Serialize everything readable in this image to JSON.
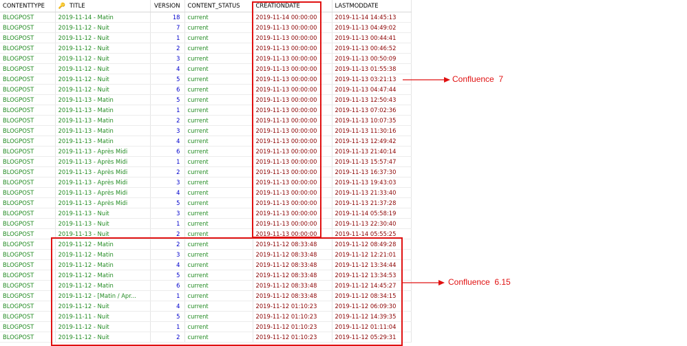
{
  "columns": {
    "contenttype": "CONTENTTYPE",
    "title": "TITLE",
    "version": "VERSION",
    "content_status": "CONTENT_STATUS",
    "creationdate": "CREATIONDATE",
    "lastmoddate": "LASTMODDATE"
  },
  "rows": [
    {
      "type": "BLOGPOST",
      "title": "2019-11-14 - Matin",
      "version": "18",
      "status": "current",
      "created": "2019-11-14 00:00:00",
      "modified": "2019-11-14 14:45:13"
    },
    {
      "type": "BLOGPOST",
      "title": "2019-11-12 - Nuit",
      "version": "7",
      "status": "current",
      "created": "2019-11-13 00:00:00",
      "modified": "2019-11-13 04:49:02"
    },
    {
      "type": "BLOGPOST",
      "title": "2019-11-12 - Nuit",
      "version": "1",
      "status": "current",
      "created": "2019-11-13 00:00:00",
      "modified": "2019-11-13 00:44:41"
    },
    {
      "type": "BLOGPOST",
      "title": "2019-11-12 - Nuit",
      "version": "2",
      "status": "current",
      "created": "2019-11-13 00:00:00",
      "modified": "2019-11-13 00:46:52"
    },
    {
      "type": "BLOGPOST",
      "title": "2019-11-12 - Nuit",
      "version": "3",
      "status": "current",
      "created": "2019-11-13 00:00:00",
      "modified": "2019-11-13 00:50:09"
    },
    {
      "type": "BLOGPOST",
      "title": "2019-11-12 - Nuit",
      "version": "4",
      "status": "current",
      "created": "2019-11-13 00:00:00",
      "modified": "2019-11-13 01:55:38"
    },
    {
      "type": "BLOGPOST",
      "title": "2019-11-12 - Nuit",
      "version": "5",
      "status": "current",
      "created": "2019-11-13 00:00:00",
      "modified": "2019-11-13 03:21:13"
    },
    {
      "type": "BLOGPOST",
      "title": "2019-11-12 - Nuit",
      "version": "6",
      "status": "current",
      "created": "2019-11-13 00:00:00",
      "modified": "2019-11-13 04:47:44"
    },
    {
      "type": "BLOGPOST",
      "title": "2019-11-13 - Matin",
      "version": "5",
      "status": "current",
      "created": "2019-11-13 00:00:00",
      "modified": "2019-11-13 12:50:43"
    },
    {
      "type": "BLOGPOST",
      "title": "2019-11-13 - Matin",
      "version": "1",
      "status": "current",
      "created": "2019-11-13 00:00:00",
      "modified": "2019-11-13 07:02:36"
    },
    {
      "type": "BLOGPOST",
      "title": "2019-11-13 - Matin",
      "version": "2",
      "status": "current",
      "created": "2019-11-13 00:00:00",
      "modified": "2019-11-13 10:07:35"
    },
    {
      "type": "BLOGPOST",
      "title": "2019-11-13 - Matin",
      "version": "3",
      "status": "current",
      "created": "2019-11-13 00:00:00",
      "modified": "2019-11-13 11:30:16"
    },
    {
      "type": "BLOGPOST",
      "title": "2019-11-13 - Matin",
      "version": "4",
      "status": "current",
      "created": "2019-11-13 00:00:00",
      "modified": "2019-11-13 12:49:42"
    },
    {
      "type": "BLOGPOST",
      "title": "2019-11-13 - Après Midi",
      "version": "6",
      "status": "current",
      "created": "2019-11-13 00:00:00",
      "modified": "2019-11-13 21:40:14"
    },
    {
      "type": "BLOGPOST",
      "title": "2019-11-13 - Après Midi",
      "version": "1",
      "status": "current",
      "created": "2019-11-13 00:00:00",
      "modified": "2019-11-13 15:57:47"
    },
    {
      "type": "BLOGPOST",
      "title": "2019-11-13 - Après Midi",
      "version": "2",
      "status": "current",
      "created": "2019-11-13 00:00:00",
      "modified": "2019-11-13 16:37:30"
    },
    {
      "type": "BLOGPOST",
      "title": "2019-11-13 - Après Midi",
      "version": "3",
      "status": "current",
      "created": "2019-11-13 00:00:00",
      "modified": "2019-11-13 19:43:03"
    },
    {
      "type": "BLOGPOST",
      "title": "2019-11-13 - Après Midi",
      "version": "4",
      "status": "current",
      "created": "2019-11-13 00:00:00",
      "modified": "2019-11-13 21:33:40"
    },
    {
      "type": "BLOGPOST",
      "title": "2019-11-13 - Après Midi",
      "version": "5",
      "status": "current",
      "created": "2019-11-13 00:00:00",
      "modified": "2019-11-13 21:37:28"
    },
    {
      "type": "BLOGPOST",
      "title": "2019-11-13 - Nuit",
      "version": "3",
      "status": "current",
      "created": "2019-11-13 00:00:00",
      "modified": "2019-11-14 05:58:19"
    },
    {
      "type": "BLOGPOST",
      "title": "2019-11-13 - Nuit",
      "version": "1",
      "status": "current",
      "created": "2019-11-13 00:00:00",
      "modified": "2019-11-13 22:30:40"
    },
    {
      "type": "BLOGPOST",
      "title": "2019-11-13 - Nuit",
      "version": "2",
      "status": "current",
      "created": "2019-11-13 00:00:00",
      "modified": "2019-11-14 05:55:25"
    },
    {
      "type": "BLOGPOST",
      "title": "2019-11-12 - Matin",
      "version": "2",
      "status": "current",
      "created": "2019-11-12 08:33:48",
      "modified": "2019-11-12 08:49:28"
    },
    {
      "type": "BLOGPOST",
      "title": "2019-11-12 - Matin",
      "version": "3",
      "status": "current",
      "created": "2019-11-12 08:33:48",
      "modified": "2019-11-12 12:21:01"
    },
    {
      "type": "BLOGPOST",
      "title": "2019-11-12 - Matin",
      "version": "4",
      "status": "current",
      "created": "2019-11-12 08:33:48",
      "modified": "2019-11-12 13:34:44"
    },
    {
      "type": "BLOGPOST",
      "title": "2019-11-12 - Matin",
      "version": "5",
      "status": "current",
      "created": "2019-11-12 08:33:48",
      "modified": "2019-11-12 13:34:53"
    },
    {
      "type": "BLOGPOST",
      "title": "2019-11-12 - Matin",
      "version": "6",
      "status": "current",
      "created": "2019-11-12 08:33:48",
      "modified": "2019-11-12 14:45:27"
    },
    {
      "type": "BLOGPOST",
      "title": "2019-11-12 - [Matin / Apr...",
      "version": "1",
      "status": "current",
      "created": "2019-11-12 08:33:48",
      "modified": "2019-11-12 08:34:15"
    },
    {
      "type": "BLOGPOST",
      "title": "2019-11-12 - Nuit",
      "version": "4",
      "status": "current",
      "created": "2019-11-12 01:10:23",
      "modified": "2019-11-12 06:09:30"
    },
    {
      "type": "BLOGPOST",
      "title": "2019-11-11 - Nuit",
      "version": "5",
      "status": "current",
      "created": "2019-11-12 01:10:23",
      "modified": "2019-11-12 14:39:35"
    },
    {
      "type": "BLOGPOST",
      "title": "2019-11-12 - Nuit",
      "version": "1",
      "status": "current",
      "created": "2019-11-12 01:10:23",
      "modified": "2019-11-12 01:11:04"
    },
    {
      "type": "BLOGPOST",
      "title": "2019-11-12 - Nuit",
      "version": "2",
      "status": "current",
      "created": "2019-11-12 01:10:23",
      "modified": "2019-11-12 05:29:31"
    }
  ],
  "annotations": {
    "confluence7": "Confluence  7",
    "confluence615": "Confluence  6.15"
  },
  "colors": {
    "annotation": "#e01010",
    "text_green": "#228b22",
    "text_blue": "#0000cc",
    "text_darkred": "#8b0000"
  },
  "icons": {
    "title_column": "key-icon"
  }
}
